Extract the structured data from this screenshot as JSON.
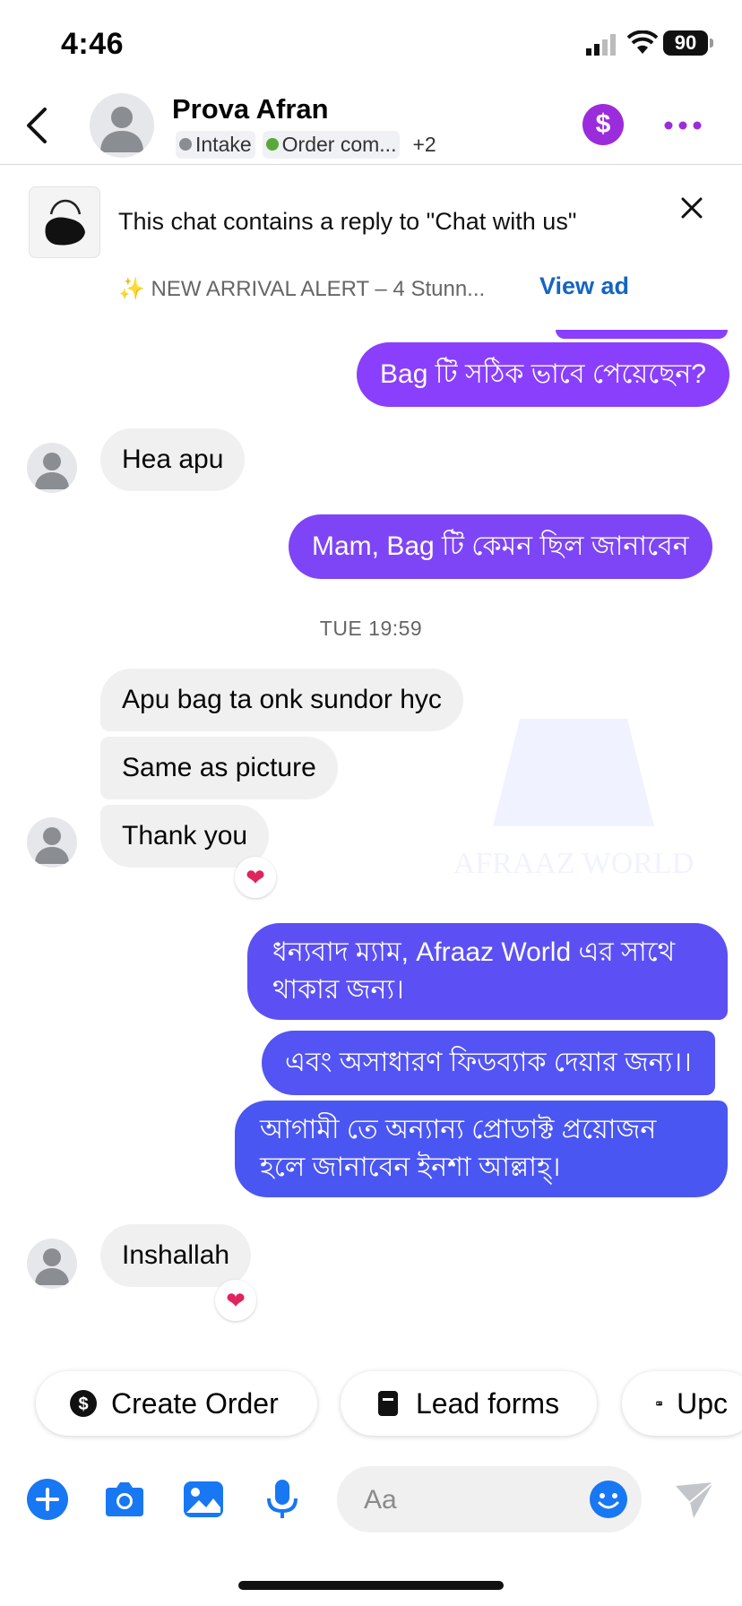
{
  "status_bar": {
    "time": "4:46",
    "battery": "90"
  },
  "header": {
    "contact_name": "Prova Afran",
    "labels": [
      {
        "text": "Intake",
        "color": "#8a8d91"
      },
      {
        "text": "Order com...",
        "color": "#5aa83c"
      }
    ],
    "more_labels": "+2",
    "dollar_icon": "$"
  },
  "ad": {
    "text": "This chat contains a reply to \"Chat with us\"",
    "subtitle": "✨ NEW ARRIVAL ALERT – 4 Stunn...",
    "link": "View ad"
  },
  "messages": [
    {
      "dir": "out",
      "text": "Bag টি সঠিক ভাবে পেয়েছেন?"
    },
    {
      "dir": "in",
      "text": "Hea apu"
    },
    {
      "dir": "out",
      "text": "Mam, Bag টি কেমন ছিল জানাবেন"
    },
    {
      "dir": "in",
      "text": "Apu bag ta onk sundor hyc"
    },
    {
      "dir": "in",
      "text": "Same as picture"
    },
    {
      "dir": "in",
      "text": "Thank you",
      "reaction": "❤"
    },
    {
      "dir": "out",
      "text": "ধন্যবাদ ম্যাম, Afraaz World এর সাথে থাকার জন্য।"
    },
    {
      "dir": "out",
      "text": "এবং অসাধারণ ফিডব্যাক দেয়ার জন্য।।"
    },
    {
      "dir": "out",
      "text": "আগামী তে অন্যান্য প্রোডাক্ট প্রয়োজন হলে জানাবেন ইনশা আল্লাহ্।"
    },
    {
      "dir": "in",
      "text": "Inshallah",
      "reaction": "❤"
    }
  ],
  "timestamp": "TUE 19:59",
  "quick_replies": [
    {
      "label": "Create Order",
      "icon": "dollar-circle-icon"
    },
    {
      "label": "Lead forms",
      "icon": "document-icon"
    },
    {
      "label": "Upc",
      "icon": "card-icon"
    }
  ],
  "composer": {
    "placeholder": "Aa"
  },
  "colors": {
    "accent_purple": "#9b2cdb",
    "bubble_purple": "#8a3ffc",
    "bubble_blue": "#4a56f2",
    "icon_blue": "#1877f2"
  }
}
